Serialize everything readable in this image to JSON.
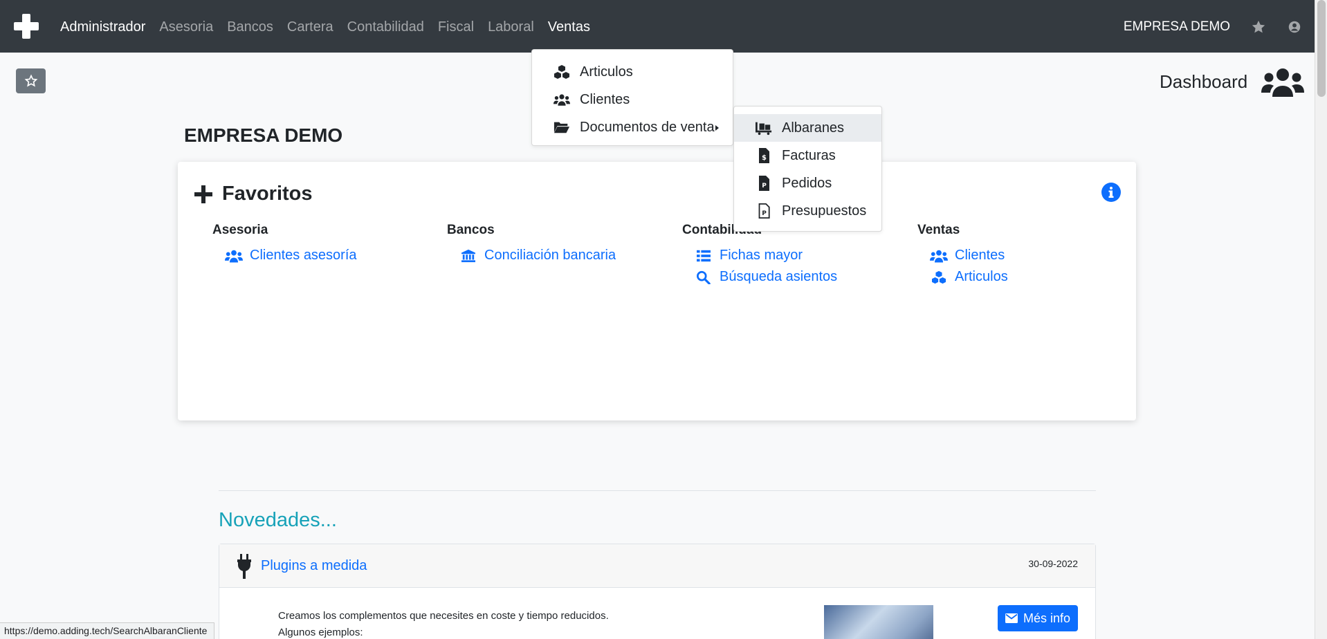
{
  "navbar": {
    "menu": [
      "Administrador",
      "Asesoria",
      "Bancos",
      "Cartera",
      "Contabilidad",
      "Fiscal",
      "Laboral",
      "Ventas"
    ],
    "company": "EMPRESA DEMO"
  },
  "header": {
    "dashboard_label": "Dashboard",
    "company_title": "EMPRESA DEMO"
  },
  "favorites": {
    "title": "Favoritos",
    "columns": [
      {
        "heading": "Asesoria",
        "links": [
          {
            "label": "Clientes asesoría",
            "icon": "users-icon"
          }
        ]
      },
      {
        "heading": "Bancos",
        "links": [
          {
            "label": "Conciliación bancaria",
            "icon": "bank-icon"
          }
        ]
      },
      {
        "heading": "Contabilidad",
        "links": [
          {
            "label": "Fichas mayor",
            "icon": "list-icon"
          },
          {
            "label": "Búsqueda asientos",
            "icon": "search-icon"
          }
        ]
      },
      {
        "heading": "Ventas",
        "links": [
          {
            "label": "Clientes",
            "icon": "users-icon"
          },
          {
            "label": "Articulos",
            "icon": "cubes-icon"
          }
        ]
      }
    ]
  },
  "novedades": {
    "title": "Novedades...",
    "item": {
      "title": "Plugins a medida",
      "date": "30-09-2022",
      "body_line1": "Creamos los complementos que necesites en coste y tiempo reducidos.",
      "body_line2": "Algunos ejemplos:",
      "button": "Més info"
    }
  },
  "ventas_menu": {
    "items": [
      {
        "label": "Articulos",
        "icon": "cubes-icon"
      },
      {
        "label": "Clientes",
        "icon": "users-icon"
      },
      {
        "label": "Documentos de venta",
        "icon": "folder-open-icon"
      }
    ]
  },
  "documentos_submenu": {
    "items": [
      {
        "label": "Albaranes",
        "icon": "dolly-icon"
      },
      {
        "label": "Facturas",
        "icon": "invoice-icon"
      },
      {
        "label": "Pedidos",
        "icon": "order-icon"
      },
      {
        "label": "Presupuestos",
        "icon": "quote-icon"
      }
    ],
    "highlighted": "Albaranes"
  },
  "status_bar": {
    "url": "https://demo.adding.tech/SearchAlbaranCliente"
  },
  "colors": {
    "navbar": "#343a40",
    "link": "#0d6efd",
    "novedades": "#17a2b8"
  }
}
